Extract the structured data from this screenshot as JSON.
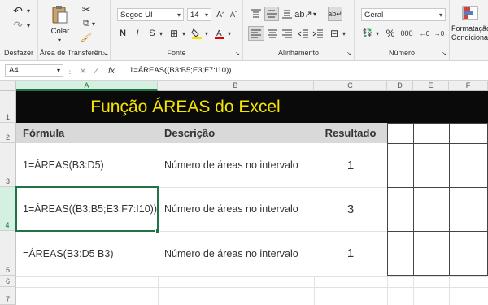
{
  "ribbon": {
    "clipboard": {
      "label": "Desfazer",
      "paste_label": "Colar",
      "group_label": "Área de Transferên..."
    },
    "font": {
      "name": "Segoe UI",
      "size": "14",
      "bold": "N",
      "italic": "I",
      "underline": "S",
      "group_label": "Fonte"
    },
    "alignment": {
      "group_label": "Alinhamento"
    },
    "number": {
      "format": "Geral",
      "percent": "%",
      "thousands": "000",
      "group_label": "Número"
    },
    "styles": {
      "label": "Formatação Condicional"
    }
  },
  "formula_bar": {
    "name_box": "A4",
    "fx": "fx",
    "formula": "1=ÁREAS((B3:B5;E3;F7:I10))"
  },
  "columns": [
    "A",
    "B",
    "C",
    "D",
    "E",
    "F"
  ],
  "rows": [
    "1",
    "2",
    "3",
    "4",
    "5",
    "6",
    "7"
  ],
  "title": "Função ÁREAS do Excel",
  "table": {
    "headers": [
      "Fórmula",
      "Descrição",
      "Resultado"
    ],
    "rows": [
      {
        "formula": "1=ÁREAS(B3:D5)",
        "description": "Número de áreas no intervalo",
        "result": "1"
      },
      {
        "formula": "1=ÁREAS((B3:B5;E3;F7:I10))",
        "description": "Número de áreas no intervalo",
        "result": "3"
      },
      {
        "formula": "=ÁREAS(B3:D5 B3)",
        "description": "Número de áreas no intervalo",
        "result": "1"
      }
    ]
  },
  "colors": {
    "title_bg": "#0a0a0a",
    "title_text": "#f5e400",
    "header_bg": "#d9d9d9",
    "selection": "#217346"
  }
}
